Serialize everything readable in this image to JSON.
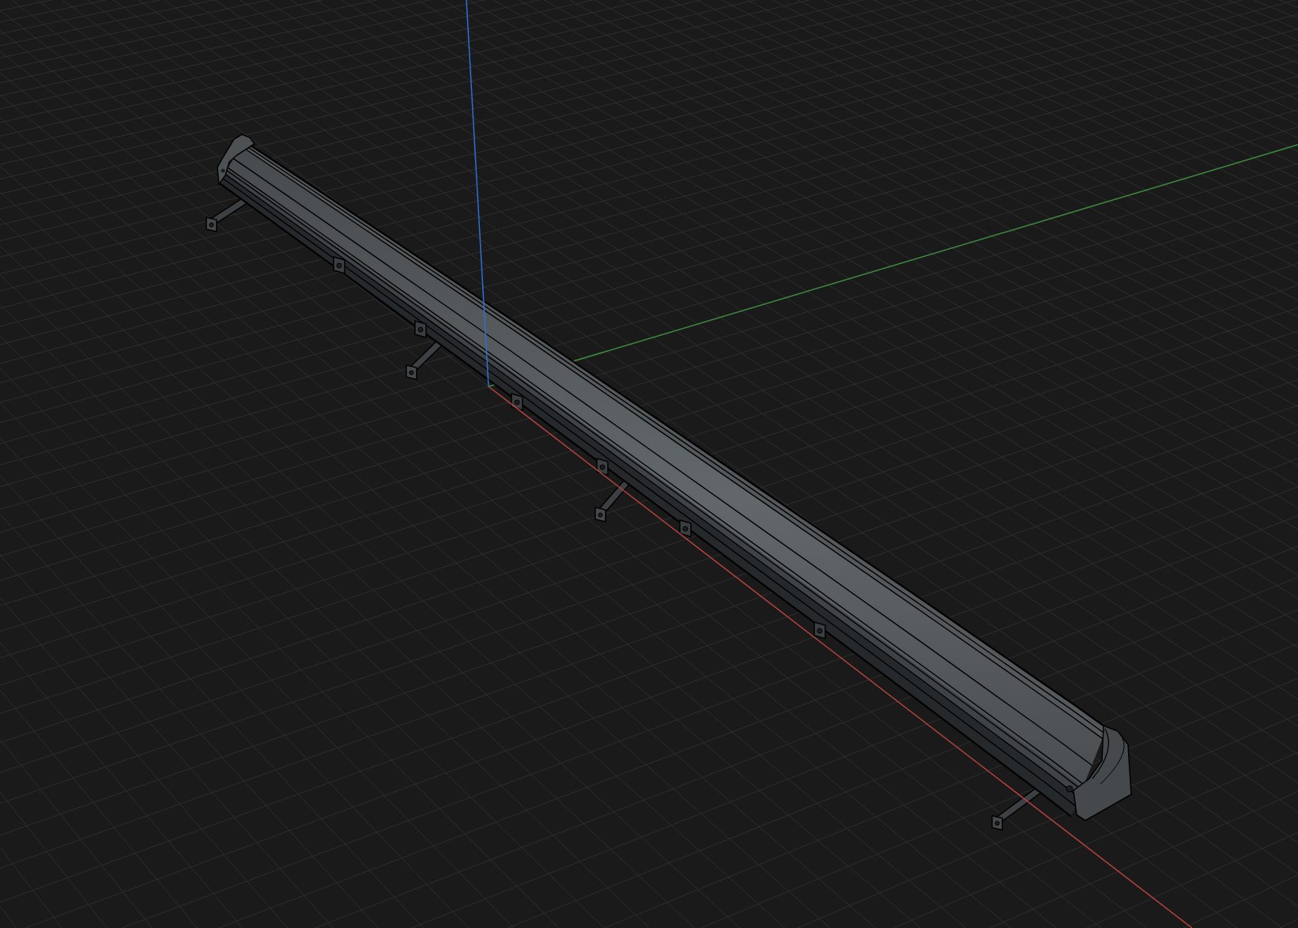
{
  "viewport": {
    "axes": [
      {
        "kind": "x",
        "color": "#b8433f"
      },
      {
        "kind": "y",
        "color": "#3d8c3f"
      },
      {
        "kind": "z",
        "color": "#2f6fd0"
      }
    ]
  }
}
